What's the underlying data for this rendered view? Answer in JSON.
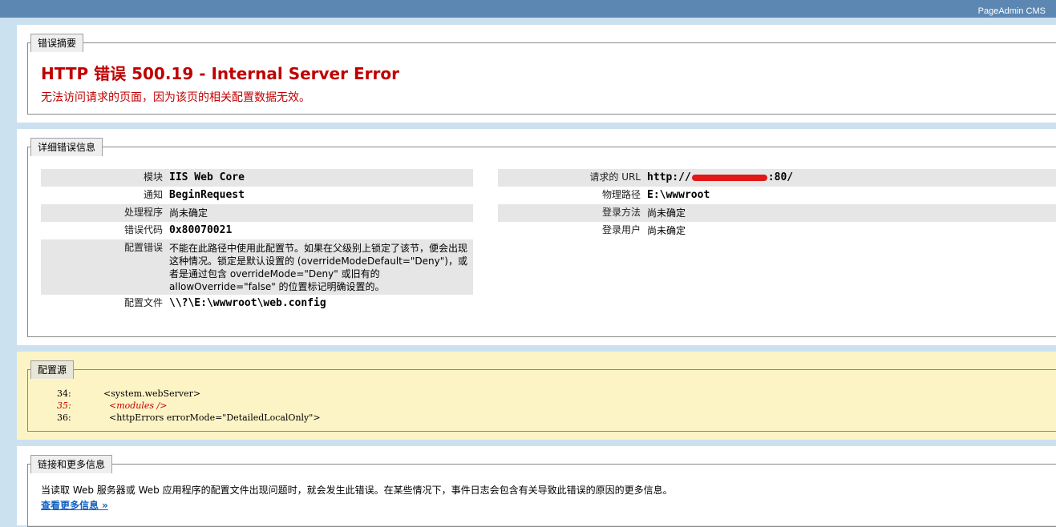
{
  "header": {
    "brand": "PageAdmin CMS"
  },
  "summary": {
    "legend": "错误摘要",
    "title": "HTTP 错误 500.19 - Internal Server Error",
    "subtitle": "无法访问请求的页面，因为该页的相关配置数据无效。"
  },
  "details": {
    "legend": "详细错误信息",
    "left": [
      {
        "key": "模块",
        "value": "IIS Web Core"
      },
      {
        "key": "通知",
        "value": "BeginRequest"
      },
      {
        "key": "处理程序",
        "value": "尚未确定"
      },
      {
        "key": "错误代码",
        "value": "0x80070021"
      },
      {
        "key": "配置错误",
        "value": "不能在此路径中使用此配置节。如果在父级别上锁定了该节，便会出现这种情况。锁定是默认设置的 (overrideModeDefault=\"Deny\")，或者是通过包含 overrideMode=\"Deny\" 或旧有的 allowOverride=\"false\" 的位置标记明确设置的。"
      },
      {
        "key": "配置文件",
        "value": "\\\\?\\E:\\wwwroot\\web.config"
      }
    ],
    "right": [
      {
        "key": "请求的 URL",
        "value_prefix": "http://",
        "value_suffix": ":80/"
      },
      {
        "key": "物理路径",
        "value": "E:\\wwwroot"
      },
      {
        "key": "登录方法",
        "value": "尚未确定"
      },
      {
        "key": "登录用户",
        "value": "尚未确定"
      }
    ]
  },
  "config_source": {
    "legend": "配置源",
    "lines": [
      {
        "num": "34:",
        "code": "<system.webServer>"
      },
      {
        "num": "35:",
        "code": "  <modules />"
      },
      {
        "num": "36:",
        "code": "  <httpErrors errorMode=\"DetailedLocalOnly\">"
      }
    ]
  },
  "links": {
    "legend": "链接和更多信息",
    "text": "当读取 Web 服务器或 Web 应用程序的配置文件出现问题时，就会发生此错误。在某些情况下，事件日志会包含有关导致此错误的原因的更多信息。",
    "more_link": "查看更多信息 »"
  }
}
